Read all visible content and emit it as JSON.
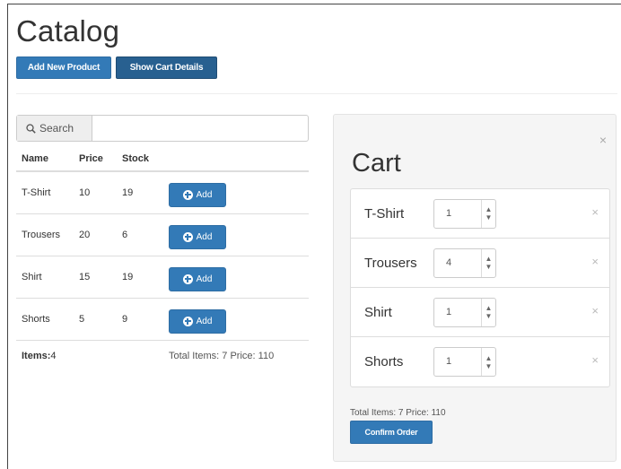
{
  "catalog": {
    "title": "Catalog",
    "add_new_product_label": "Add New Product",
    "show_cart_details_label": "Show Cart Details",
    "search_label": "Search",
    "search_value": "",
    "columns": [
      "Name",
      "Price",
      "Stock"
    ],
    "add_button_label": "Add",
    "products": [
      {
        "name": "T-Shirt",
        "price": "10",
        "stock": "19"
      },
      {
        "name": "Trousers",
        "price": "20",
        "stock": "6"
      },
      {
        "name": "Shirt",
        "price": "15",
        "stock": "19"
      },
      {
        "name": "Shorts",
        "price": "5",
        "stock": "9"
      }
    ],
    "items_label": "Items:",
    "items_count": "4",
    "totals_text": "Total Items: 7 Price: 110"
  },
  "cart": {
    "title": "Cart",
    "close_glyph": "×",
    "items": [
      {
        "name": "T-Shirt",
        "qty": "1"
      },
      {
        "name": "Trousers",
        "qty": "4"
      },
      {
        "name": "Shirt",
        "qty": "1"
      },
      {
        "name": "Shorts",
        "qty": "1"
      }
    ],
    "summary": "Total Items: 7 Price: 110",
    "confirm_label": "Confirm Order"
  },
  "colors": {
    "primary": "#337ab7",
    "primary_dark": "#286090",
    "panel_bg": "#f5f5f5"
  }
}
